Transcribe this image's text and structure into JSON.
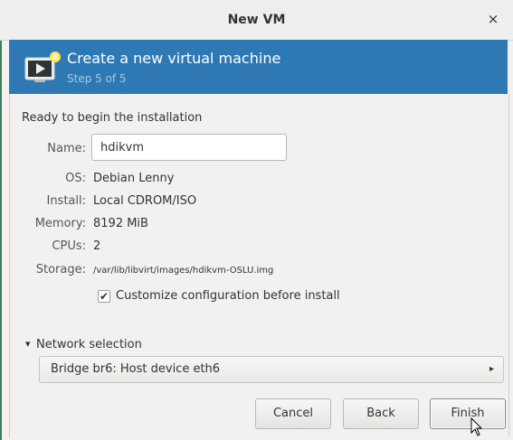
{
  "window": {
    "title": "New VM",
    "close_glyph": "×"
  },
  "banner": {
    "title": "Create a new virtual machine",
    "step": "Step 5 of 5",
    "icon": "virtual-machine-icon",
    "color": "#2e79b4"
  },
  "summary": {
    "heading": "Ready to begin the installation",
    "name_label": "Name:",
    "name_value": "hdikvm",
    "os_label": "OS:",
    "os_value": "Debian Lenny",
    "install_label": "Install:",
    "install_value": "Local CDROM/ISO",
    "memory_label": "Memory:",
    "memory_value": "8192 MiB",
    "cpus_label": "CPUs:",
    "cpus_value": "2",
    "storage_label": "Storage:",
    "storage_value": "/var/lib/libvirt/images/hdikvm-OSLU.img",
    "customize_label": "Customize configuration before install",
    "customize_checked": true,
    "check_glyph": "✔"
  },
  "network": {
    "expander_glyph": "▾",
    "label": "Network selection",
    "selected": "Bridge br6: Host device eth6",
    "arrow_glyph": "▸"
  },
  "buttons": {
    "cancel": "Cancel",
    "back": "Back",
    "finish": "Finish"
  }
}
